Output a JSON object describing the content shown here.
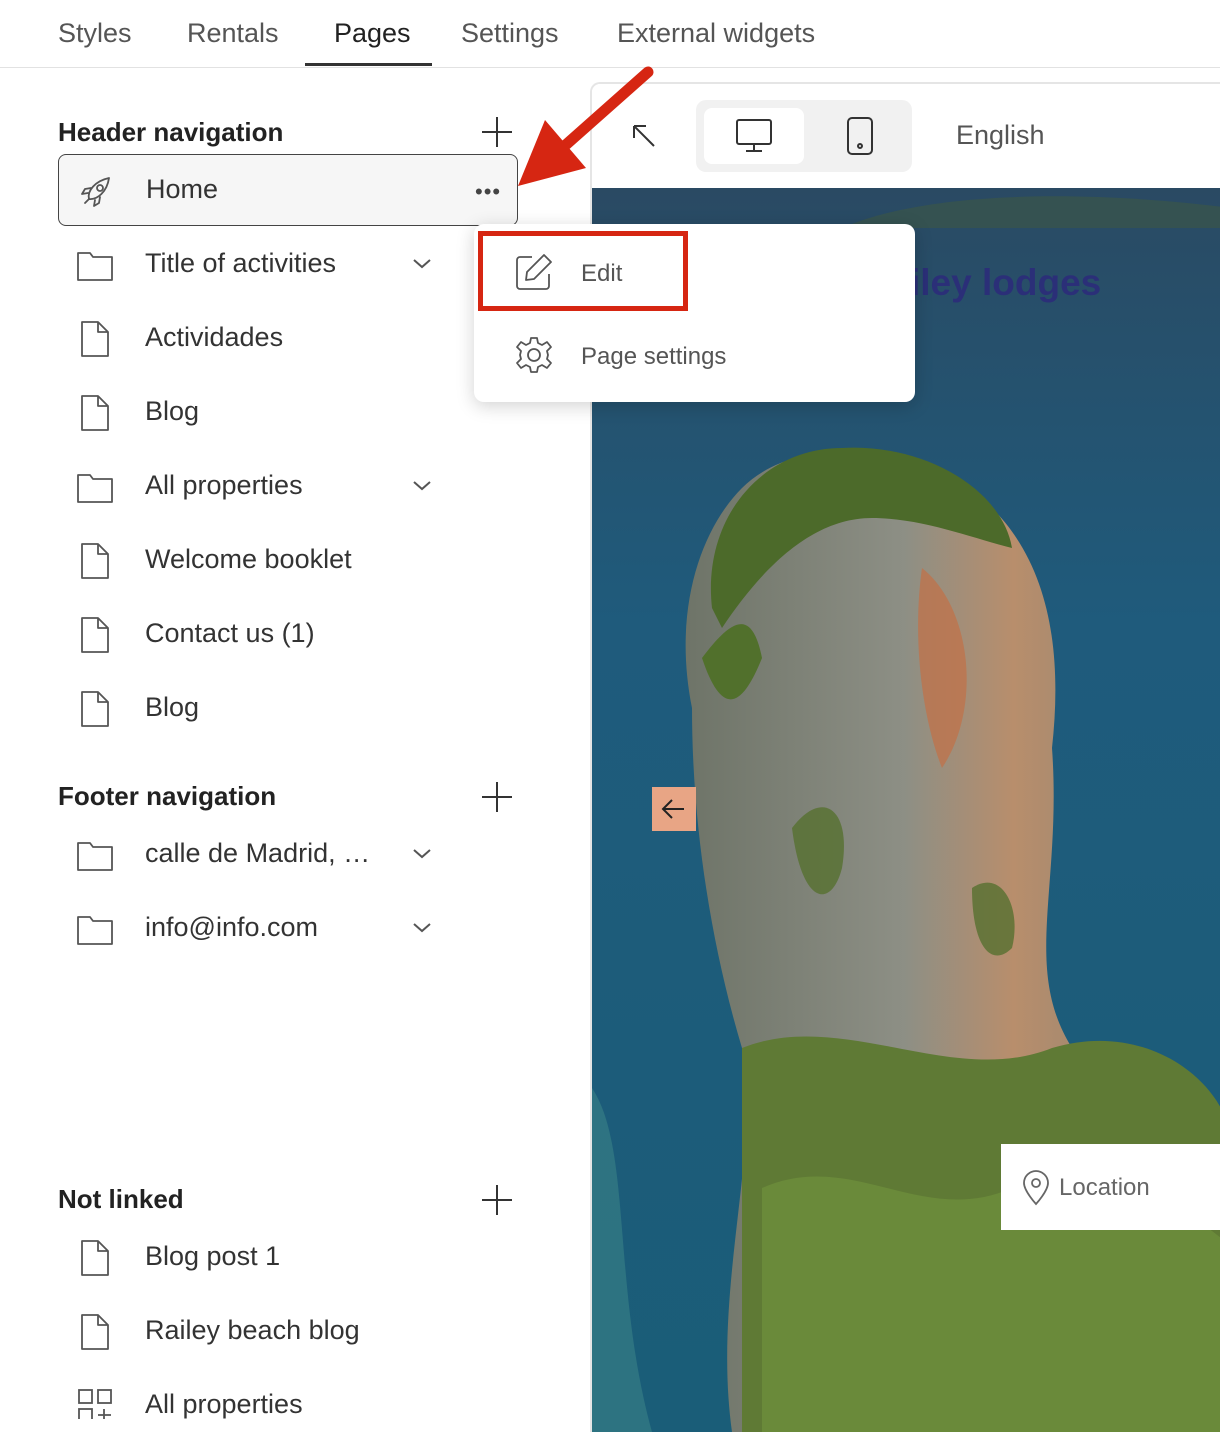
{
  "tabs": [
    {
      "label": "Styles"
    },
    {
      "label": "Rentals"
    },
    {
      "label": "Pages"
    },
    {
      "label": "Settings"
    },
    {
      "label": "External widgets"
    }
  ],
  "active_tab": "Pages",
  "sidebar": {
    "header_nav": {
      "title": "Header navigation",
      "items": [
        {
          "label": "Home",
          "icon": "rocket-icon",
          "selected": true
        },
        {
          "label": "Title of activities",
          "icon": "folder-icon",
          "expandable": true
        },
        {
          "label": "Actividades",
          "icon": "page-icon"
        },
        {
          "label": "Blog",
          "icon": "page-icon"
        },
        {
          "label": "All properties",
          "icon": "folder-icon",
          "expandable": true
        },
        {
          "label": "Welcome booklet",
          "icon": "page-icon"
        },
        {
          "label": "Contact us (1)",
          "icon": "page-icon"
        },
        {
          "label": "Blog",
          "icon": "page-icon"
        }
      ]
    },
    "footer_nav": {
      "title": "Footer navigation",
      "items": [
        {
          "label": "calle de Madrid, …",
          "icon": "folder-icon",
          "expandable": true
        },
        {
          "label": "info@info.com",
          "icon": "folder-icon",
          "expandable": true
        }
      ]
    },
    "not_linked": {
      "title": "Not linked",
      "items": [
        {
          "label": "Blog post 1",
          "icon": "page-icon"
        },
        {
          "label": "Railey beach blog",
          "icon": "page-icon"
        },
        {
          "label": "All properties",
          "icon": "grid-icon"
        }
      ]
    }
  },
  "context_menu": {
    "edit_label": "Edit",
    "page_settings_label": "Page settings"
  },
  "preview": {
    "language": "English",
    "brand_partial": "iley lodges",
    "location_placeholder": "Location"
  },
  "colors": {
    "highlight": "#d62612",
    "brand_text": "#2b2f78",
    "arrow_button": "#e8a585"
  }
}
